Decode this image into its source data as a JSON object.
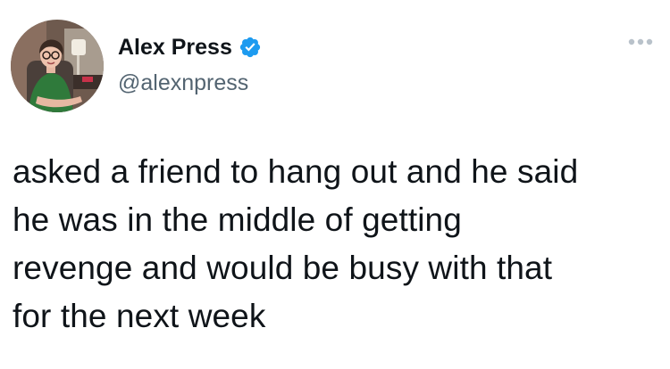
{
  "tweet": {
    "author": {
      "display_name": "Alex Press",
      "handle": "@alexnpress",
      "verified": true,
      "avatar_icon": "profile-photo"
    },
    "more_icon": "ellipsis-icon",
    "verified_icon": "verified-badge-icon",
    "text": "asked a friend to hang out and he said\nhe was in the middle of getting\nrevenge and would be busy with that\nfor the next week"
  },
  "colors": {
    "verified_blue": "#1d9bf0",
    "text_primary": "#0f1419",
    "text_secondary": "#536471",
    "more_icon": "#b9c2ca"
  }
}
